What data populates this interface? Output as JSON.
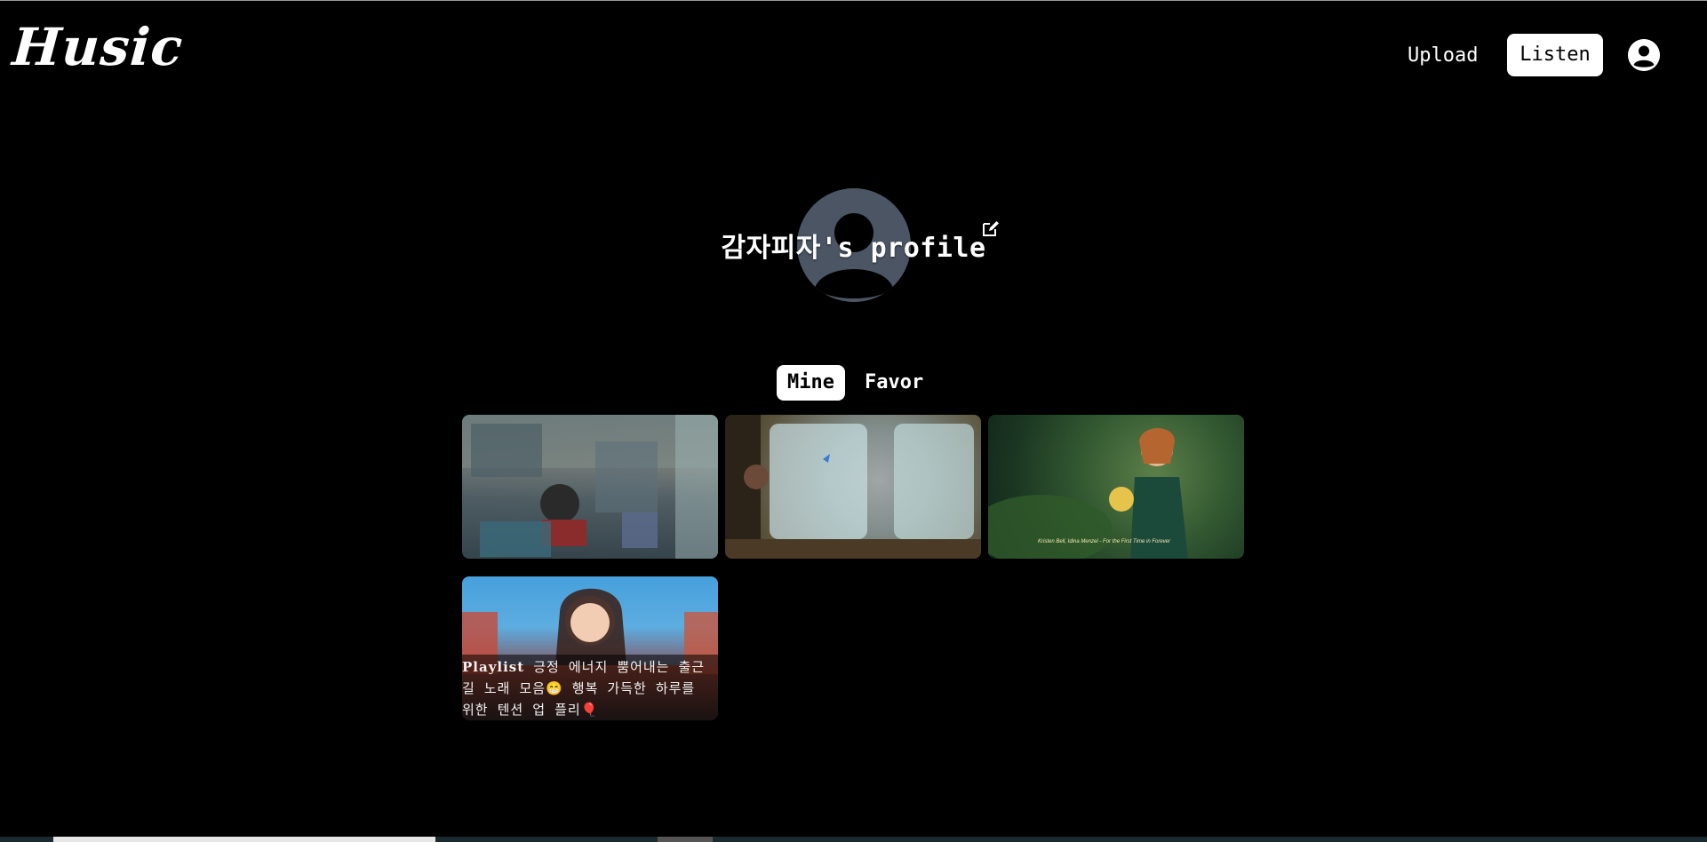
{
  "header": {
    "logo": "Husic",
    "nav": {
      "upload": "Upload",
      "listen": "Listen"
    }
  },
  "profile": {
    "title": "감자피자's profile"
  },
  "tabs": [
    {
      "label": "Mine",
      "active": true
    },
    {
      "label": "Favor",
      "active": false
    }
  ],
  "cards": [
    {
      "kind": "image"
    },
    {
      "kind": "image"
    },
    {
      "kind": "image",
      "caption": "Kristen Bell, Idina Menzel - For the First Time in Forever"
    },
    {
      "kind": "image",
      "overlay_tag": "Playlist",
      "overlay_text": " 긍정 에너지 뿜어내는 출근길 노래 모음😁 행복 가득한 하루를 위한 텐션 업 플리🎈"
    }
  ],
  "colors": {
    "background": "#000000",
    "avatar_gray": "#4b5563",
    "accent_white": "#ffffff"
  },
  "icons": {
    "user": "user-circle-icon",
    "edit": "edit-icon"
  }
}
